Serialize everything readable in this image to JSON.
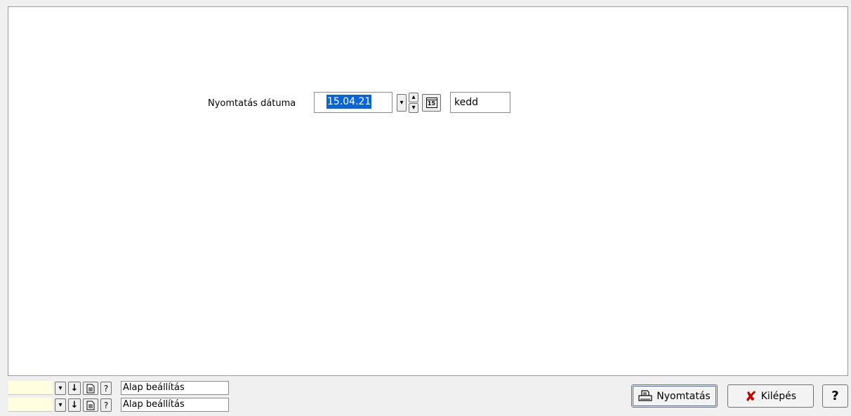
{
  "form": {
    "print_date_label": "Nyomtatás dátuma",
    "print_date_value": "15.04.21",
    "day_value": "kedd",
    "calendar_glyph": "15"
  },
  "footer_settings": [
    {
      "value": "Alap beállítás",
      "help_glyph": "?"
    },
    {
      "value": "Alap beállítás",
      "help_glyph": "?"
    }
  ],
  "buttons": {
    "print_label": "Nyomtatás",
    "exit_label": "Kilépés",
    "help_label": "?"
  },
  "icons": {
    "dropdown": "chevron-down-icon",
    "spin": "spin-updown-icon",
    "calendar": "calendar-icon",
    "arrow_down": "arrow-down-icon",
    "document": "document-icon",
    "help": "help-icon",
    "printer": "printer-icon",
    "exit": "close-x-icon"
  },
  "colors": {
    "selection": "#0a64d8",
    "yellow_field": "#ffffe0",
    "exit_x": "#c00000",
    "focus_outline": "#3d6fb6"
  }
}
